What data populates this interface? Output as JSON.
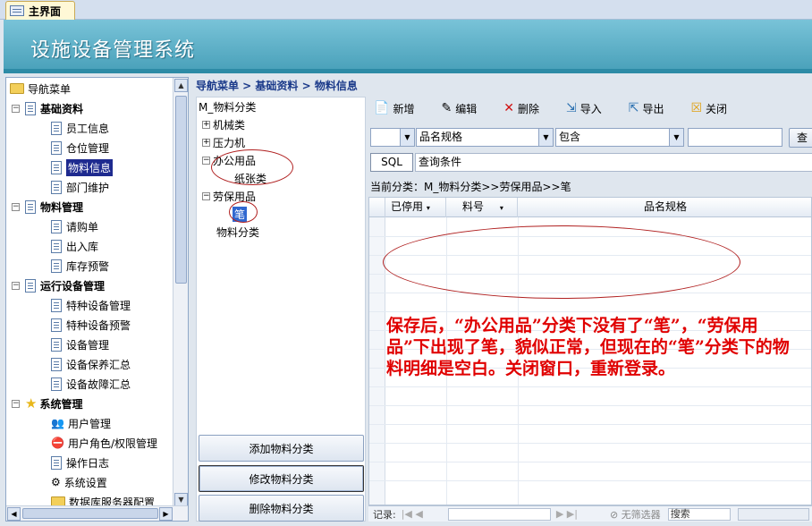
{
  "tab": {
    "label": "主界面"
  },
  "banner": {
    "title": "设施设备管理系统"
  },
  "nav": {
    "root": "导航菜单",
    "groups": [
      {
        "label": "基础资料",
        "items": [
          "员工信息",
          "仓位管理",
          "物料信息",
          "部门维护"
        ]
      },
      {
        "label": "物料管理",
        "items": [
          "请购单",
          "出入库",
          "库存预警"
        ]
      },
      {
        "label": "运行设备管理",
        "items": [
          "特种设备管理",
          "特种设备预警",
          "设备管理",
          "设备保养汇总",
          "设备故障汇总"
        ]
      },
      {
        "label": "系统管理",
        "items": [
          "用户管理",
          "用户角色/权限管理",
          "操作日志",
          "系统设置",
          "数据库服务器配置"
        ]
      }
    ]
  },
  "breadcrumb": "导航菜单 > 基础资料 > 物料信息",
  "category_tree": {
    "root": "M_物料分类",
    "nodes": [
      "机械类",
      "压力机",
      "办公用品",
      "纸张类",
      "劳保用品",
      "笔",
      "物料分类"
    ],
    "buttons": [
      "添加物料分类",
      "修改物料分类",
      "删除物料分类"
    ]
  },
  "toolbar": {
    "new": "新增",
    "edit": "编辑",
    "delete": "删除",
    "import": "导入",
    "export": "导出",
    "close": "关闭"
  },
  "filter": {
    "field": "品名规格",
    "op": "包含",
    "value": "",
    "find": "查"
  },
  "sql": {
    "button": "SQL",
    "label": "查询条件"
  },
  "current_category": "当前分类：M_物料分类>>劳保用品>>笔",
  "grid": {
    "columns": [
      "已停用",
      "料号",
      "品名规格"
    ]
  },
  "recordbar": {
    "label": "记录:",
    "filter": "无筛选器",
    "search": "搜索"
  },
  "annotation": "保存后，“办公用品”分类下没有了“笔”，“劳保用品”下出现了笔，貌似正常，但现在的“笔”分类下的物料明细是空白。关闭窗口，重新登录。",
  "colors": {
    "banner": "#4ba2bb",
    "annotation": "#e00000",
    "selection": "#1e2a8f"
  }
}
